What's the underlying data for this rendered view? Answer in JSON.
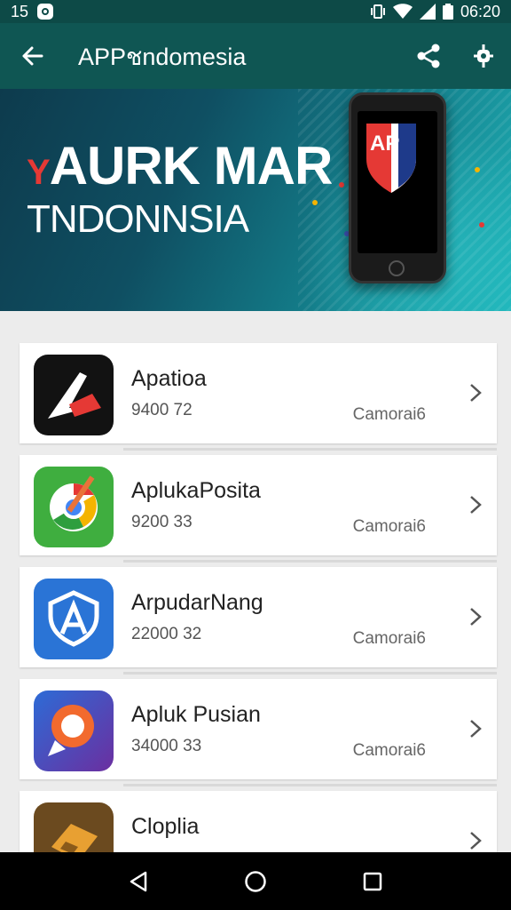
{
  "status_bar": {
    "time_left": "15",
    "time_right": "06:20"
  },
  "app_bar": {
    "title": "APPชndomesia"
  },
  "banner": {
    "accent": "Y",
    "headline": "AURK MAR",
    "subline": "TNDONNSIA",
    "shield_text": "AP"
  },
  "apps": [
    {
      "name": "Apatioa",
      "size": "9400 72",
      "category": "Camorai6",
      "icon": "brand-a-icon",
      "color": "#e53935"
    },
    {
      "name": "AplukaPosita",
      "size": "9200 33",
      "category": "Camorai6",
      "icon": "chrome-icon",
      "color": "#3fae3f"
    },
    {
      "name": "ArpudarNang",
      "size": "22000 32",
      "category": "Camorai6",
      "icon": "shield-a-icon",
      "color": "#2a74d6"
    },
    {
      "name": "Apluk Pusian",
      "size": "34000 33",
      "category": "Camorai6",
      "icon": "location-pin-icon",
      "color": "#5b3fa8"
    },
    {
      "name": "Cloplia",
      "size": "",
      "category": "",
      "icon": "game-box-icon",
      "color": "#6b4a1f"
    }
  ]
}
